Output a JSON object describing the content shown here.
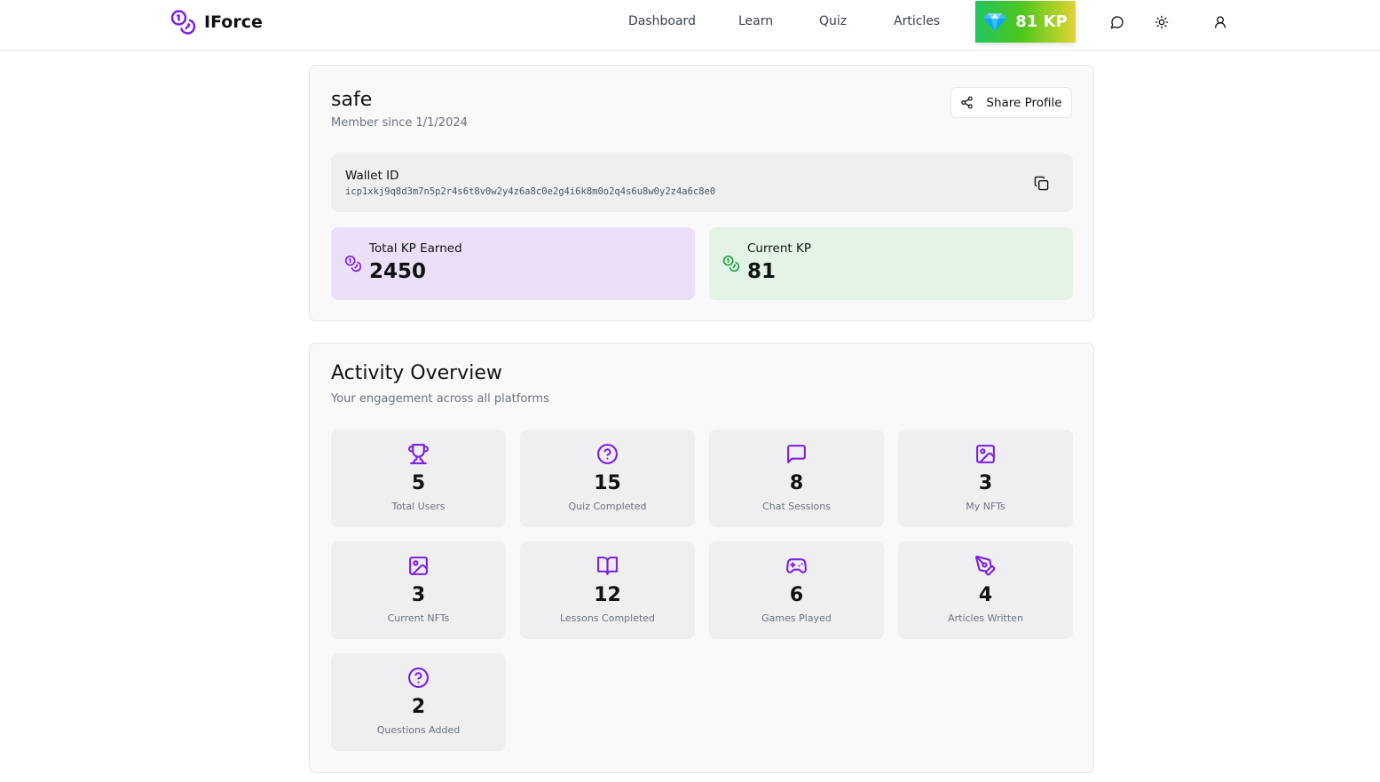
{
  "header": {
    "brand": "IForce",
    "nav": [
      "Dashboard",
      "Learn",
      "Quiz",
      "Articles"
    ],
    "kp_badge": "81 KP"
  },
  "profile": {
    "username": "safe",
    "member_since": "Member since 1/1/2024",
    "share_label": "Share Profile",
    "wallet_label": "Wallet ID",
    "wallet_id": "icp1xkj9q8d3m7n5p2r4s6t8v0w2y4z6a8c0e2g4i6k8m0o2q4s6u8w0y2z4a6c8e0",
    "total_kp_label": "Total KP Earned",
    "total_kp_value": "2450",
    "current_kp_label": "Current KP",
    "current_kp_value": "81"
  },
  "activity": {
    "title": "Activity Overview",
    "subtitle": "Your engagement across all platforms",
    "stats": [
      {
        "icon": "trophy-icon",
        "value": "5",
        "label": "Total Users"
      },
      {
        "icon": "help-circle-icon",
        "value": "15",
        "label": "Quiz Completed"
      },
      {
        "icon": "message-square-icon",
        "value": "8",
        "label": "Chat Sessions"
      },
      {
        "icon": "image-icon",
        "value": "3",
        "label": "My NFTs"
      },
      {
        "icon": "image-icon",
        "value": "3",
        "label": "Current NFTs"
      },
      {
        "icon": "book-open-icon",
        "value": "12",
        "label": "Lessons Completed"
      },
      {
        "icon": "gamepad-icon",
        "value": "6",
        "label": "Games Played"
      },
      {
        "icon": "pen-tool-icon",
        "value": "4",
        "label": "Articles Written"
      },
      {
        "icon": "help-circle-icon",
        "value": "2",
        "label": "Questions Added"
      }
    ]
  },
  "colors": {
    "accent": "#7c1fe0",
    "success": "#22a34a",
    "total_kp_bg": "#ecdff8",
    "current_kp_bg": "#e3f4e6"
  }
}
